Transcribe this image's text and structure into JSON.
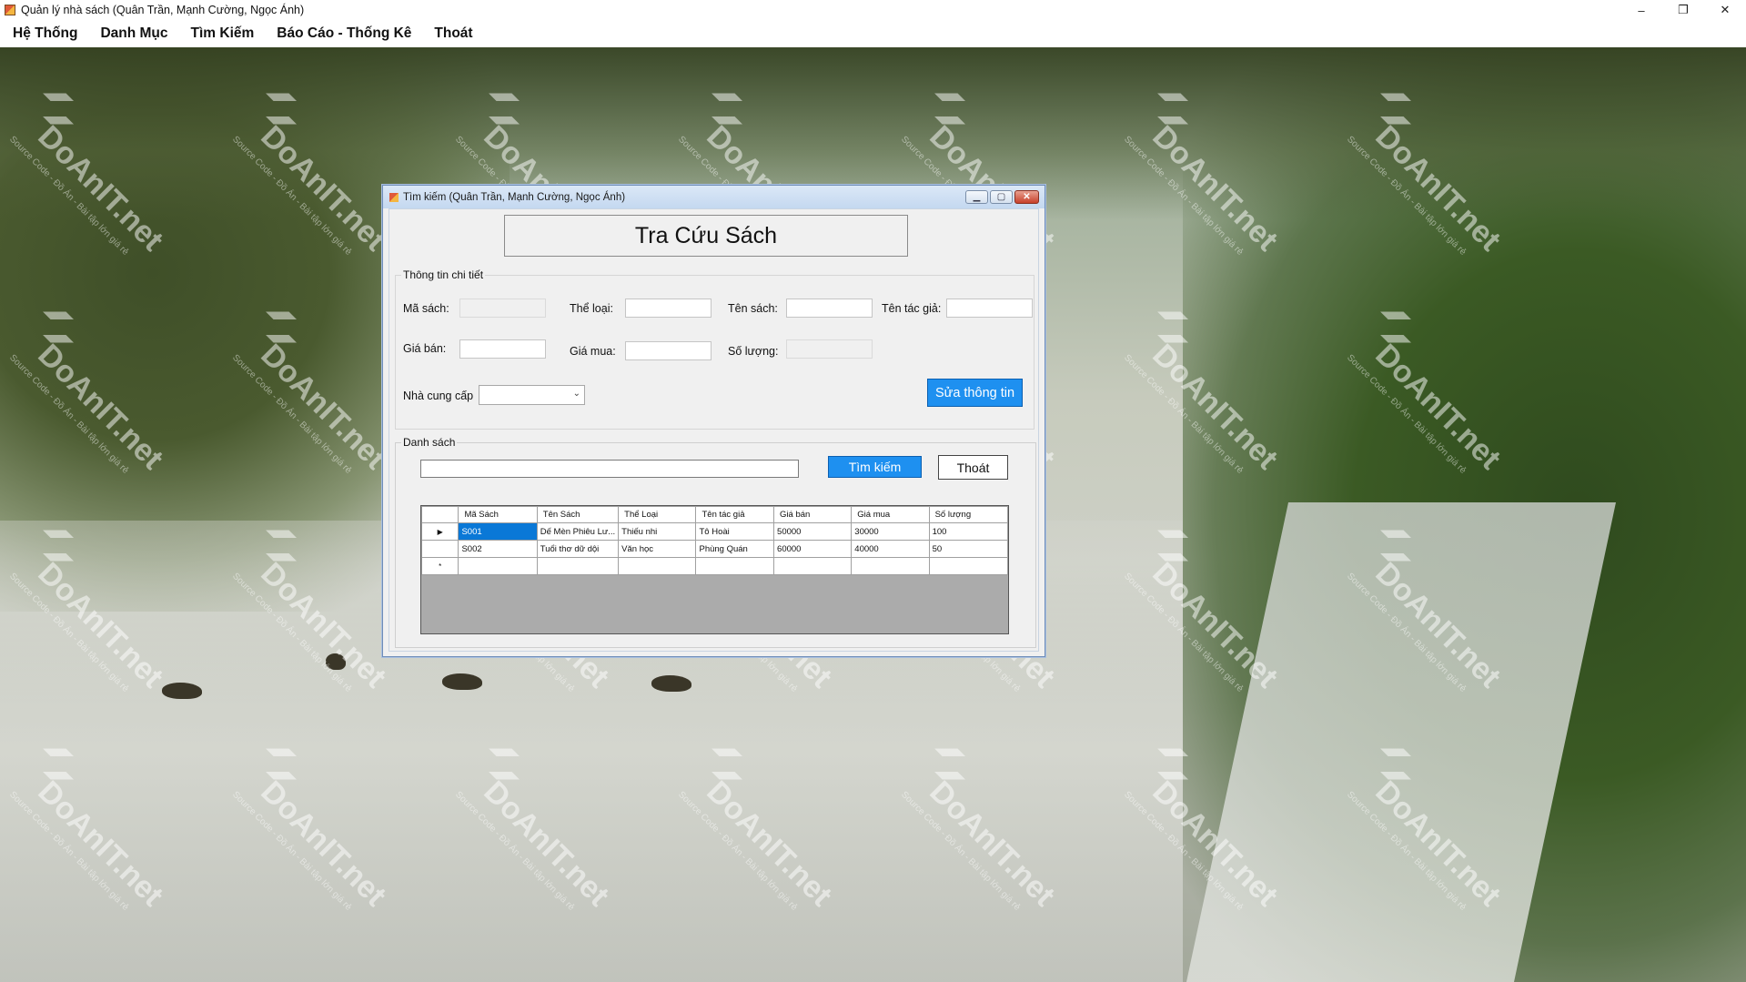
{
  "window": {
    "title": "Quản lý nhà sách (Quân Trần, Mạnh Cường, Ngọc Ánh)",
    "minimize": "–",
    "maximize": "❐",
    "close": "✕"
  },
  "menu": {
    "items": [
      "Hệ Thống",
      "Danh Mục",
      "Tìm Kiếm",
      "Báo Cáo - Thống Kê",
      "Thoát"
    ]
  },
  "watermark": {
    "brand": "DoAnIT.net",
    "tagline": "Source Code - Đồ Án - Bài tập lớn giá rẻ"
  },
  "dialog": {
    "title": "Tìm kiếm (Quân Trần, Mạnh Cường, Ngọc Ánh)",
    "heading": "Tra Cứu Sách",
    "detail_group": "Thông tin chi tiết",
    "labels": {
      "ma_sach": "Mã sách:",
      "the_loai": "Thể loại:",
      "ten_sach": "Tên sách:",
      "ten_tac_gia": "Tên tác giả:",
      "gia_ban": "Giá bán:",
      "gia_mua": "Giá mua:",
      "so_luong": "Số lượng:",
      "nha_cung_cap": "Nhà cung cấp"
    },
    "fields": {
      "ma_sach": "",
      "the_loai": "",
      "ten_sach": "",
      "ten_tac_gia": "",
      "gia_ban": "",
      "gia_mua": "",
      "so_luong": "",
      "nha_cung_cap": ""
    },
    "edit_button": "Sửa thông tin",
    "list_group": "Danh sách",
    "search_value": "",
    "search_button": "Tìm kiếm",
    "exit_button": "Thoát",
    "grid": {
      "columns": [
        "Mã Sách",
        "Tên Sách",
        "Thể Loại",
        "Tên tác giả",
        "Giá bán",
        "Giá mua",
        "Số lượng"
      ],
      "rows": [
        [
          "S001",
          "Dế Mèn Phiêu Lư...",
          "Thiếu nhi",
          "Tô Hoài",
          "50000",
          "30000",
          "100"
        ],
        [
          "S002",
          "Tuổi thơ dữ dội",
          "Văn học",
          "Phùng Quán",
          "60000",
          "40000",
          "50"
        ]
      ],
      "current_row_marker": "▶",
      "new_row_marker": "*"
    }
  },
  "colors": {
    "accent_button": "#1e90f0",
    "selected_cell": "#0a78d7"
  }
}
